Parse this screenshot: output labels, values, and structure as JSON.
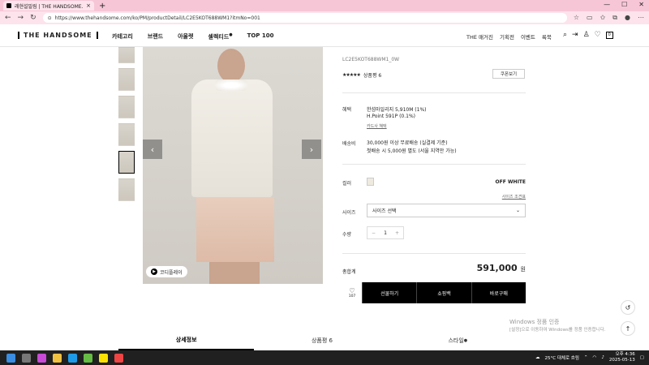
{
  "browser": {
    "tab_title": "래현설밀림 | THE HANDSOME.CO",
    "tab_close": "×",
    "new_tab": "+",
    "url": "https://www.thehandsome.com/ko/PM/productDetail/LC2E5KOT688WM1?itmNo=001",
    "win_minimize": "—",
    "win_maximize": "☐",
    "win_close": "✕"
  },
  "header": {
    "logo": "THE HANDSOME",
    "nav": [
      "카테고리",
      "브랜드",
      "아울렛",
      "셀렉티드",
      "TOP 100"
    ],
    "nav_sup": "●",
    "right_nav": [
      "THE 매거진",
      "기획전",
      "이벤트",
      "룩북"
    ],
    "cart_count": "0"
  },
  "gallery": {
    "prev": "‹",
    "next": "›",
    "code_button": "코디플레이"
  },
  "product": {
    "sku": "LC2E5KOT688WM1_0W",
    "stars": "★★★★★",
    "review_label": "상품평 6",
    "coupon_button": "쿠폰보기",
    "benefit_label": "혜택",
    "benefit_line1": "한섬마일리지   5,910M (1%)",
    "benefit_line2": "H.Point          591P (0.1%)",
    "card_benefit_link": "카드사 혜택",
    "shipping_label": "배송비",
    "shipping_line1": "30,000원 이상 무료배송 (실결제 기준)",
    "shipping_line2": "첫배송 시 5,000원 별도 (서울 지역만 가능)",
    "color_label": "컬러",
    "color_name": "OFF WHITE",
    "size_guide_link": "사이즈 조견표",
    "size_label": "사이즈",
    "size_placeholder": "사이즈 선택",
    "qty_label": "수량",
    "qty_minus": "−",
    "qty_value": "1",
    "qty_plus": "+",
    "total_label": "총합계",
    "total_price": "591,000",
    "total_unit": "원",
    "like_count": "107",
    "btn_gift": "선물하기",
    "btn_cart": "쇼핑백",
    "btn_buy": "바로구매"
  },
  "detail_tabs": {
    "tab1": "상세정보",
    "tab2": "상품평 6",
    "tab3": "스타일",
    "tab3_sup": "●"
  },
  "watermark": {
    "line1": "Windows 정품 인증",
    "line2": "[설정]으로 이동하여 Windows를 정품 인증합니다."
  },
  "taskbar": {
    "weather": "25°C  대체로 흐림",
    "time": "오후 4:36",
    "date": "2025-05-13"
  }
}
